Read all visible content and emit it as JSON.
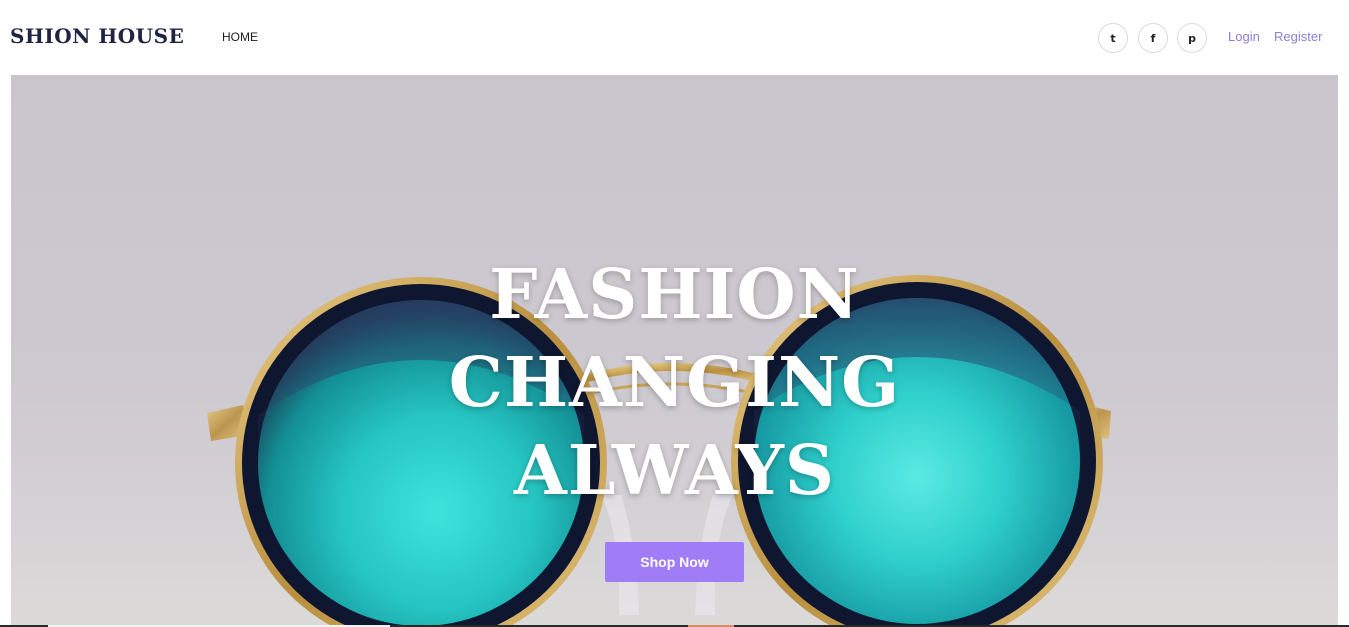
{
  "header": {
    "brand": "SHION HOUSE",
    "nav": {
      "home": "HOME"
    },
    "social": [
      {
        "icon": "twitter-icon",
        "glyph": "t"
      },
      {
        "icon": "facebook-icon",
        "glyph": "f"
      },
      {
        "icon": "pinterest-icon",
        "glyph": "p"
      }
    ],
    "auth": {
      "login": "Login",
      "register": "Register"
    }
  },
  "hero": {
    "headline": [
      "FASHION",
      "CHANGING",
      "ALWAYS"
    ],
    "cta": "Shop Now"
  },
  "colors": {
    "brand_text": "#1f2444",
    "auth_link": "#8c80d6",
    "cta_button": "#a07cf7",
    "lens": "#2fc9c6"
  }
}
